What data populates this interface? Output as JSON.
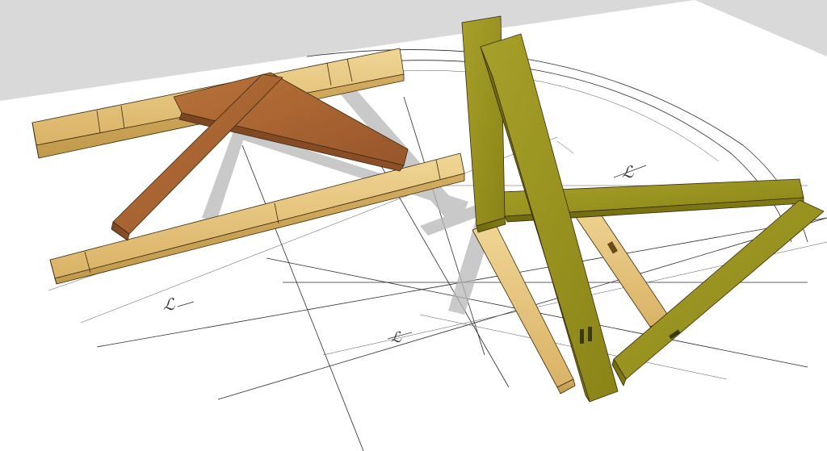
{
  "scene": {
    "background_color": "#d9d9d9",
    "drawing_sheet_color": "#ffffff",
    "light_timber_color": "#e3c27a",
    "dark_timber_color": "#a0602c",
    "green_timber_color": "#8f8a1c",
    "shadow_color": "#b8b8b8"
  },
  "annotations": {
    "mark_left": "ℒ",
    "mark_center": "ℒ",
    "mark_right": "ℒ"
  }
}
